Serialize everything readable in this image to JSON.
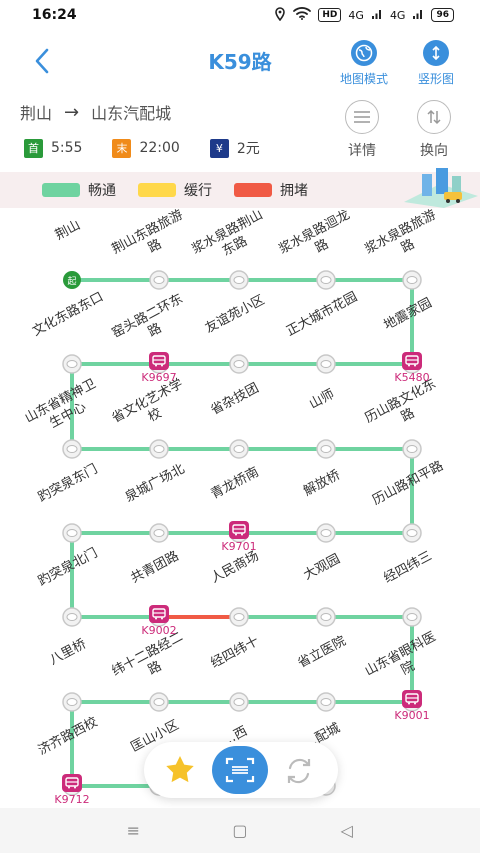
{
  "status": {
    "time": "16:24",
    "hd": "HD",
    "sig1": "4G",
    "sig2": "4G",
    "battery": "96"
  },
  "header": {
    "title": "K59路",
    "map_mode": "地图模式",
    "vertical_mode": "竖形图"
  },
  "line": {
    "from": "荆山",
    "arrow": "→",
    "to": "山东汽配城",
    "details": "详情",
    "switch_direction": "换向"
  },
  "times": {
    "first_badge": "首",
    "first_time": "5:55",
    "last_badge": "末",
    "last_time": "22:00",
    "fare_badge": "¥",
    "fare": "2元"
  },
  "legend": {
    "smooth": "畅通",
    "slow": "缓行",
    "congested": "拥堵"
  },
  "colors": {
    "accent": "#3a8fdc",
    "smooth": "#6fd3a0",
    "slow": "#ffd84a",
    "congested": "#f05a45",
    "bus": "#cc2b7a",
    "first": "#2a9a3a",
    "last": "#f08b1a",
    "fare": "#1e3a8a"
  },
  "stations": [
    {
      "name": "荆山",
      "start_badge": "起"
    },
    {
      "name": "荆山东路旅游路"
    },
    {
      "name": "浆水泉路荆山东路"
    },
    {
      "name": "浆水泉路迴龙路"
    },
    {
      "name": "浆水泉路旅游路"
    },
    {
      "name": "地震家园"
    },
    {
      "name": "正大城市花园"
    },
    {
      "name": "友谊苑小区"
    },
    {
      "name": "窑头路二环东路"
    },
    {
      "name": "文化东路东口"
    },
    {
      "name": "山东省精神卫生中心"
    },
    {
      "name": "省文化艺术学校"
    },
    {
      "name": "省杂技团"
    },
    {
      "name": "山师"
    },
    {
      "name": "历山路文化东路"
    },
    {
      "name": "历山路和平路"
    },
    {
      "name": "解放桥"
    },
    {
      "name": "青龙桥南"
    },
    {
      "name": "泉城广场北"
    },
    {
      "name": "趵突泉东门"
    },
    {
      "name": "趵突泉北门"
    },
    {
      "name": "共青团路"
    },
    {
      "name": "人民商场"
    },
    {
      "name": "大观园"
    },
    {
      "name": "经四纬三"
    },
    {
      "name": "山东省眼科医院"
    },
    {
      "name": "省立医院"
    },
    {
      "name": "经四纬十"
    },
    {
      "name": "纬十二路经二路"
    },
    {
      "name": "八里桥"
    },
    {
      "name": "济齐路西校"
    },
    {
      "name": "匡山小区"
    },
    {
      "name": "…西"
    },
    {
      "name": "…配城"
    }
  ],
  "buses": [
    {
      "plate": "K5480"
    },
    {
      "plate": "K9697"
    },
    {
      "plate": "K9701"
    },
    {
      "plate": "K9002"
    },
    {
      "plate": "K9001"
    },
    {
      "plate": "K9712"
    }
  ],
  "toolbar": {
    "favorite": "收藏",
    "scan": "扫码",
    "refresh": "刷新"
  },
  "nav": {
    "menu": "≡",
    "home": "▢",
    "back": "◁"
  }
}
